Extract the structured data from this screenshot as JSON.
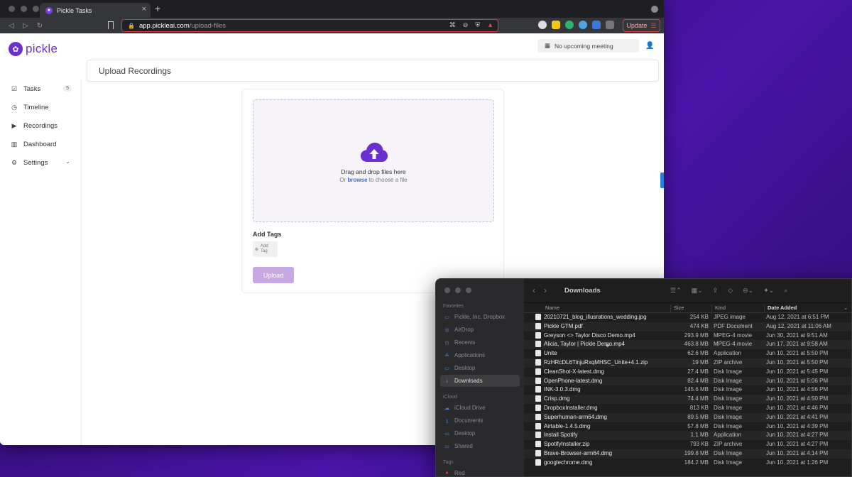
{
  "browser": {
    "tab_title": "Pickle Tasks",
    "url_host": "app.pickleai.com",
    "url_path": "/upload-files",
    "update_label": "Update"
  },
  "app": {
    "logo_text": "pickle",
    "meeting_text": "No upcoming meeting",
    "page_title": "Upload Recordings",
    "sidebar": [
      {
        "label": "Tasks",
        "badge": "5",
        "icon": "checkbox-icon"
      },
      {
        "label": "Timeline",
        "icon": "clock-icon"
      },
      {
        "label": "Recordings",
        "icon": "video-icon"
      },
      {
        "label": "Dashboard",
        "icon": "chart-icon"
      },
      {
        "label": "Settings",
        "icon": "gear-icon"
      }
    ],
    "dropzone": {
      "title": "Drag and drop files here",
      "sub_prefix": "Or",
      "sub_link": "browse",
      "sub_suffix": "to choose a file"
    },
    "add_tags_label": "Add Tags",
    "add_tag_button": "Add Tag",
    "upload_button": "Upload"
  },
  "finder": {
    "title": "Downloads",
    "sections": {
      "favorites": "Favorites",
      "icloud": "iCloud",
      "tags": "Tags"
    },
    "favorites": [
      "Pickle, Inc. Dropbox",
      "AirDrop",
      "Recents",
      "Applications",
      "Desktop",
      "Downloads"
    ],
    "icloud": [
      "iCloud Drive",
      "Documents",
      "Desktop",
      "Shared"
    ],
    "tags": [
      "Red"
    ],
    "columns": [
      "Name",
      "Size",
      "Kind",
      "Date Added"
    ],
    "files": [
      {
        "name": "20210721_blog_illusrations_wedding.jpg",
        "size": "254 KB",
        "kind": "JPEG image",
        "date": "Aug 12, 2021 at 6:51 PM"
      },
      {
        "name": "Pickle GTM.pdf",
        "size": "474 KB",
        "kind": "PDF Document",
        "date": "Aug 12, 2021 at 11:06 AM"
      },
      {
        "name": "Greyson <> Taylor Disco Demo.mp4",
        "size": "293.9 MB",
        "kind": "MPEG-4 movie",
        "date": "Jun 30, 2021 at 9:51 AM"
      },
      {
        "name": "Alicia, Taylor | Pickle Demo.mp4",
        "size": "463.8 MB",
        "kind": "MPEG-4 movie",
        "date": "Jun 17, 2021 at 9:58 AM"
      },
      {
        "name": "Unite",
        "size": "62.6 MB",
        "kind": "Application",
        "date": "Jun 10, 2021 at 5:50 PM"
      },
      {
        "name": "RzHRcDL6TinjuRxqMHSC_Unite+4.1.zip",
        "size": "19 MB",
        "kind": "ZIP archive",
        "date": "Jun 10, 2021 at 5:50 PM"
      },
      {
        "name": "CleanShot-X-latest.dmg",
        "size": "27.4 MB",
        "kind": "Disk Image",
        "date": "Jun 10, 2021 at 5:45 PM"
      },
      {
        "name": "OpenPhone-latest.dmg",
        "size": "82.4 MB",
        "kind": "Disk Image",
        "date": "Jun 10, 2021 at 5:06 PM"
      },
      {
        "name": "INK-3.0.3.dmg",
        "size": "145.6 MB",
        "kind": "Disk Image",
        "date": "Jun 10, 2021 at 4:56 PM"
      },
      {
        "name": "Crisp.dmg",
        "size": "74.4 MB",
        "kind": "Disk Image",
        "date": "Jun 10, 2021 at 4:50 PM"
      },
      {
        "name": "DropboxInstaller.dmg",
        "size": "813 KB",
        "kind": "Disk Image",
        "date": "Jun 10, 2021 at 4:46 PM"
      },
      {
        "name": "Superhuman-arm64.dmg",
        "size": "89.5 MB",
        "kind": "Disk Image",
        "date": "Jun 10, 2021 at 4:41 PM"
      },
      {
        "name": "Airtable-1.4.5.dmg",
        "size": "57.8 MB",
        "kind": "Disk Image",
        "date": "Jun 10, 2021 at 4:39 PM"
      },
      {
        "name": "Install Spotify",
        "size": "1.1 MB",
        "kind": "Application",
        "date": "Jun 10, 2021 at 4:27 PM"
      },
      {
        "name": "SpotifyInstaller.zip",
        "size": "793 KB",
        "kind": "ZIP archive",
        "date": "Jun 10, 2021 at 4:27 PM"
      },
      {
        "name": "Brave-Browser-arm64.dmg",
        "size": "199.8 MB",
        "kind": "Disk Image",
        "date": "Jun 10, 2021 at 4:14 PM"
      },
      {
        "name": "googlechrome.dmg",
        "size": "184.2 MB",
        "kind": "Disk Image",
        "date": "Jun 10, 2021 at 1:26 PM"
      }
    ]
  }
}
